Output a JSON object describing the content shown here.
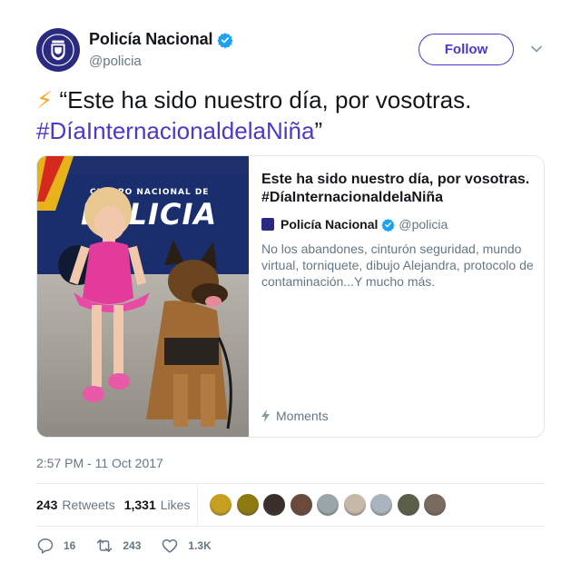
{
  "header": {
    "display_name": "Policía Nacional",
    "handle": "@policia",
    "follow_label": "Follow"
  },
  "tweet": {
    "bolt": "⚡",
    "text": "“Este ha sido nuestro día, por vosotras.",
    "hashtag": "#DíaInternacionaldelaNiña",
    "close_quote": "”"
  },
  "card": {
    "image_lettering": "CUERPO NACIONAL DE POLICIA",
    "title": "Este ha sido nuestro día, por vosotras. #DíaInternacionaldelaNiña",
    "author_name": "Policía Nacional",
    "author_handle": "@policia",
    "description": "No los abandones, cinturón seguridad, mundo virtual, torniquete, dibujo Alejandra, protocolo de contaminación...Y mucho más.",
    "footer_label": "Moments"
  },
  "timestamp": "2:57 PM - 11 Oct 2017",
  "stats": {
    "retweets_count": "243",
    "retweets_label": "Retweets",
    "likes_count": "1,331",
    "likes_label": "Likes"
  },
  "likers": [
    {
      "color": "#c8a020"
    },
    {
      "color": "#8c7a10"
    },
    {
      "color": "#3a2f2a"
    },
    {
      "color": "#6a4a3a"
    },
    {
      "color": "#9aa6a8"
    },
    {
      "color": "#c8b8a8"
    },
    {
      "color": "#aab4be"
    },
    {
      "color": "#5a6048"
    },
    {
      "color": "#7a6a60"
    }
  ],
  "actions": {
    "reply_count": "16",
    "retweet_count": "243",
    "like_count": "1.3K"
  },
  "colors": {
    "accent": "#4a3ac9",
    "verified": "#1da1f2",
    "muted": "#657786"
  },
  "icons": [
    "verified-badge-icon",
    "chevron-down-icon",
    "moments-bolt-icon",
    "reply-icon",
    "retweet-icon",
    "heart-icon"
  ]
}
